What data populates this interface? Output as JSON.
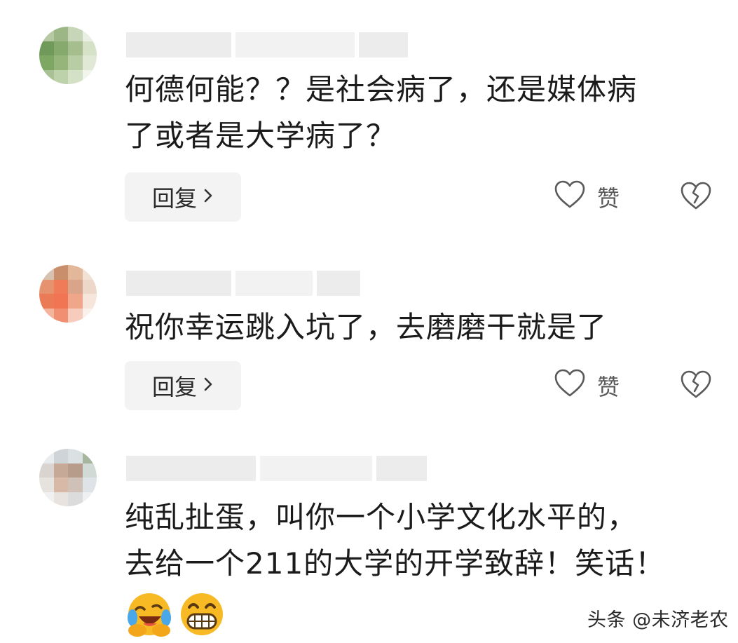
{
  "comments": [
    {
      "text": "何德何能？？是社会病了，还是媒体病\n了或者是大学病了？",
      "reply_label": "回复",
      "like_label": "赞"
    },
    {
      "text": "祝你幸运跳入坑了，去磨磨干就是了",
      "reply_label": "回复",
      "like_label": "赞"
    },
    {
      "text": "纯乱扯蛋，叫你一个小学文化水平的，\n去给一个211的大学的开学致辞！笑话！",
      "emojis": [
        "laughing-crying-emoji",
        "grinning-emoji"
      ]
    }
  ],
  "icons": {
    "reply_chevron": "chevron-right-icon",
    "like": "heart-outline-icon",
    "dislike": "broken-heart-icon"
  },
  "watermark": "头条 @未济老农",
  "colors": {
    "text": "#1b1b1b",
    "reply_bg": "#f3f3f3",
    "icon": "#5a5a5a",
    "emoji": "#f7b924"
  }
}
